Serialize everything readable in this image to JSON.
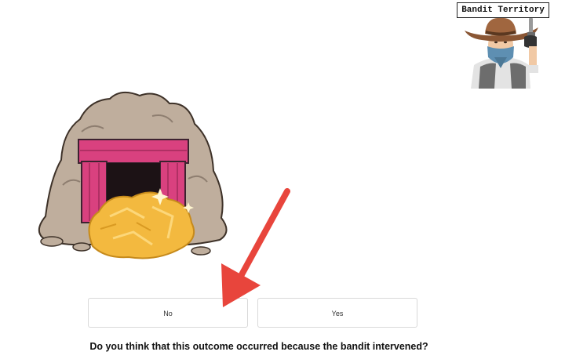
{
  "territory": {
    "label": "Bandit Territory",
    "image": "bandit-cowboy-illustration"
  },
  "scene": {
    "image": "mine-entrance-with-gold-nugget",
    "pointer": "red-arrow-icon"
  },
  "buttons": {
    "no_label": "No",
    "yes_label": "Yes"
  },
  "question": "Do you think that this outcome occurred because the bandit intervened?",
  "colors": {
    "arrow": "#e8453c",
    "mine_frame": "#d9417f",
    "rock": "#b9a898",
    "gold": "#f3b93f"
  }
}
